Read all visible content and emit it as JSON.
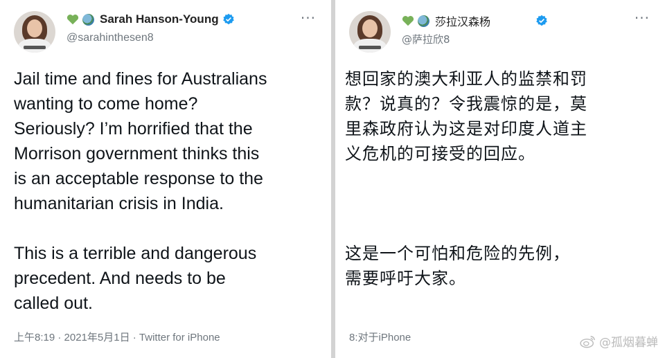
{
  "left_tweet": {
    "emoji_icons": [
      "green-heart-icon",
      "globe-icon"
    ],
    "display_name": "Sarah Hanson-Young",
    "handle": "@sarahinthesen8",
    "more_label": "···",
    "body": "Jail time and fines for Australians\nwanting to come home?\nSeriously? I’m horrified that the\nMorrison government thinks this\nis an acceptable response to the\nhumanitarian crisis in India.\n\nThis is a terrible and dangerous\nprecedent. And needs to be\ncalled out.",
    "footer": "上午8:19 · 2021年5月1日 · Twitter for iPhone"
  },
  "right_tweet": {
    "emoji_icons": [
      "green-heart-icon",
      "globe-icon"
    ],
    "display_name": "莎拉汉森杨",
    "handle": "@萨拉欣8",
    "more_label": "···",
    "body": "想回家的澳大利亚人的监禁和罚\n款？说真的？令我震惊的是，莫\n里森政府认为这是对印度人道主\n义危机的可接受的回应。\n\n\n\n这是一个可怕和危险的先例，\n需要呼吁大家。",
    "footer": "8:对于iPhone"
  },
  "watermark": {
    "text": "@孤烟暮蝉",
    "icon": "weibo-logo-icon"
  },
  "colors": {
    "verified_blue": "#1d9bf0",
    "heart_green": "#78b159",
    "text": "#0f1419",
    "muted": "#6e767d"
  }
}
